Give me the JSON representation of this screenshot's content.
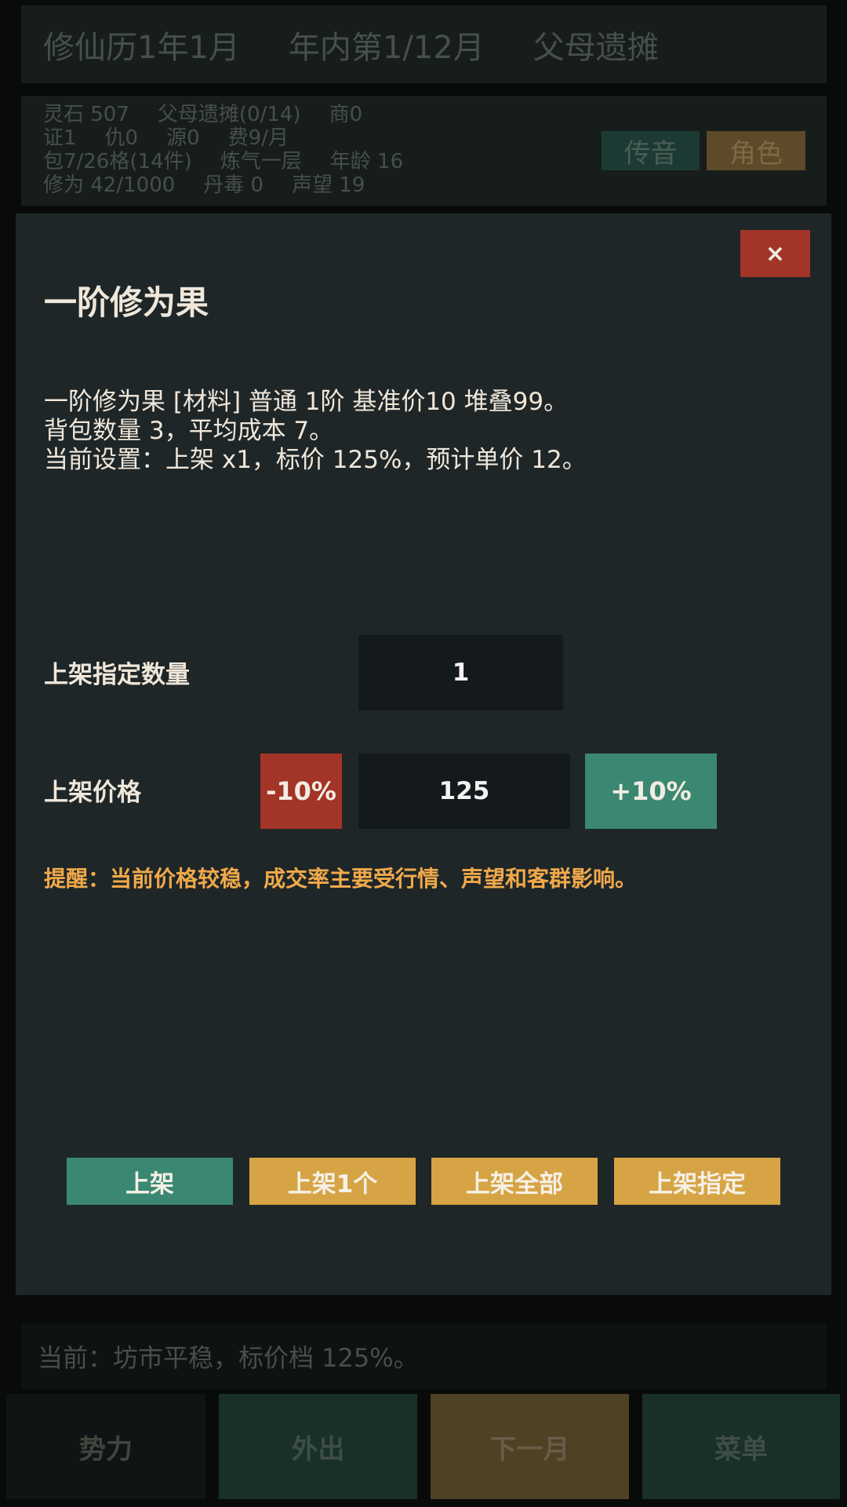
{
  "header": {
    "calendar": "修仙历1年1月",
    "month_progress": "年内第1/12月",
    "location": "父母遗摊"
  },
  "stats": {
    "line1": [
      "灵石 507",
      "父母遗摊(0/14)",
      "商0"
    ],
    "line2": [
      "证1",
      "仇0",
      "源0",
      "费9/月"
    ],
    "line3": [
      "包7/26格(14件)",
      "炼气一层",
      "年龄 16"
    ],
    "line4": [
      "修为 42/1000",
      "丹毒 0",
      "声望 19"
    ],
    "chuanyin_label": "传音",
    "juese_label": "角色"
  },
  "modal": {
    "close_label": "×",
    "title": "一阶修为果",
    "desc_line1": "一阶修为果 [材料]  普通  1阶  基准价10  堆叠99。",
    "desc_line2": "背包数量 3，平均成本 7。",
    "desc_line3": "当前设置：上架 x1，标价 125%，预计单价 12。",
    "qty_label": "上架指定数量",
    "qty_value": "1",
    "price_label": "上架价格",
    "minus_label": "-10%",
    "price_value": "125",
    "plus_label": "+10%",
    "hint": "提醒：当前价格较稳，成交率主要受行情、声望和客群影响。",
    "actions": {
      "list": "上架",
      "list_one": "上架1个",
      "list_all": "上架全部",
      "list_specified": "上架指定"
    }
  },
  "status": {
    "text": "当前：坊市平稳，标价档 125%。"
  },
  "nav": {
    "shili": "势力",
    "waichu": "外出",
    "xiayiyue": "下一月",
    "caidan": "菜单"
  },
  "colors": {
    "green_accent": "#3b8872",
    "gold_accent": "#d6a444",
    "red_accent": "#a33428",
    "warning_text": "#f0a94a"
  }
}
